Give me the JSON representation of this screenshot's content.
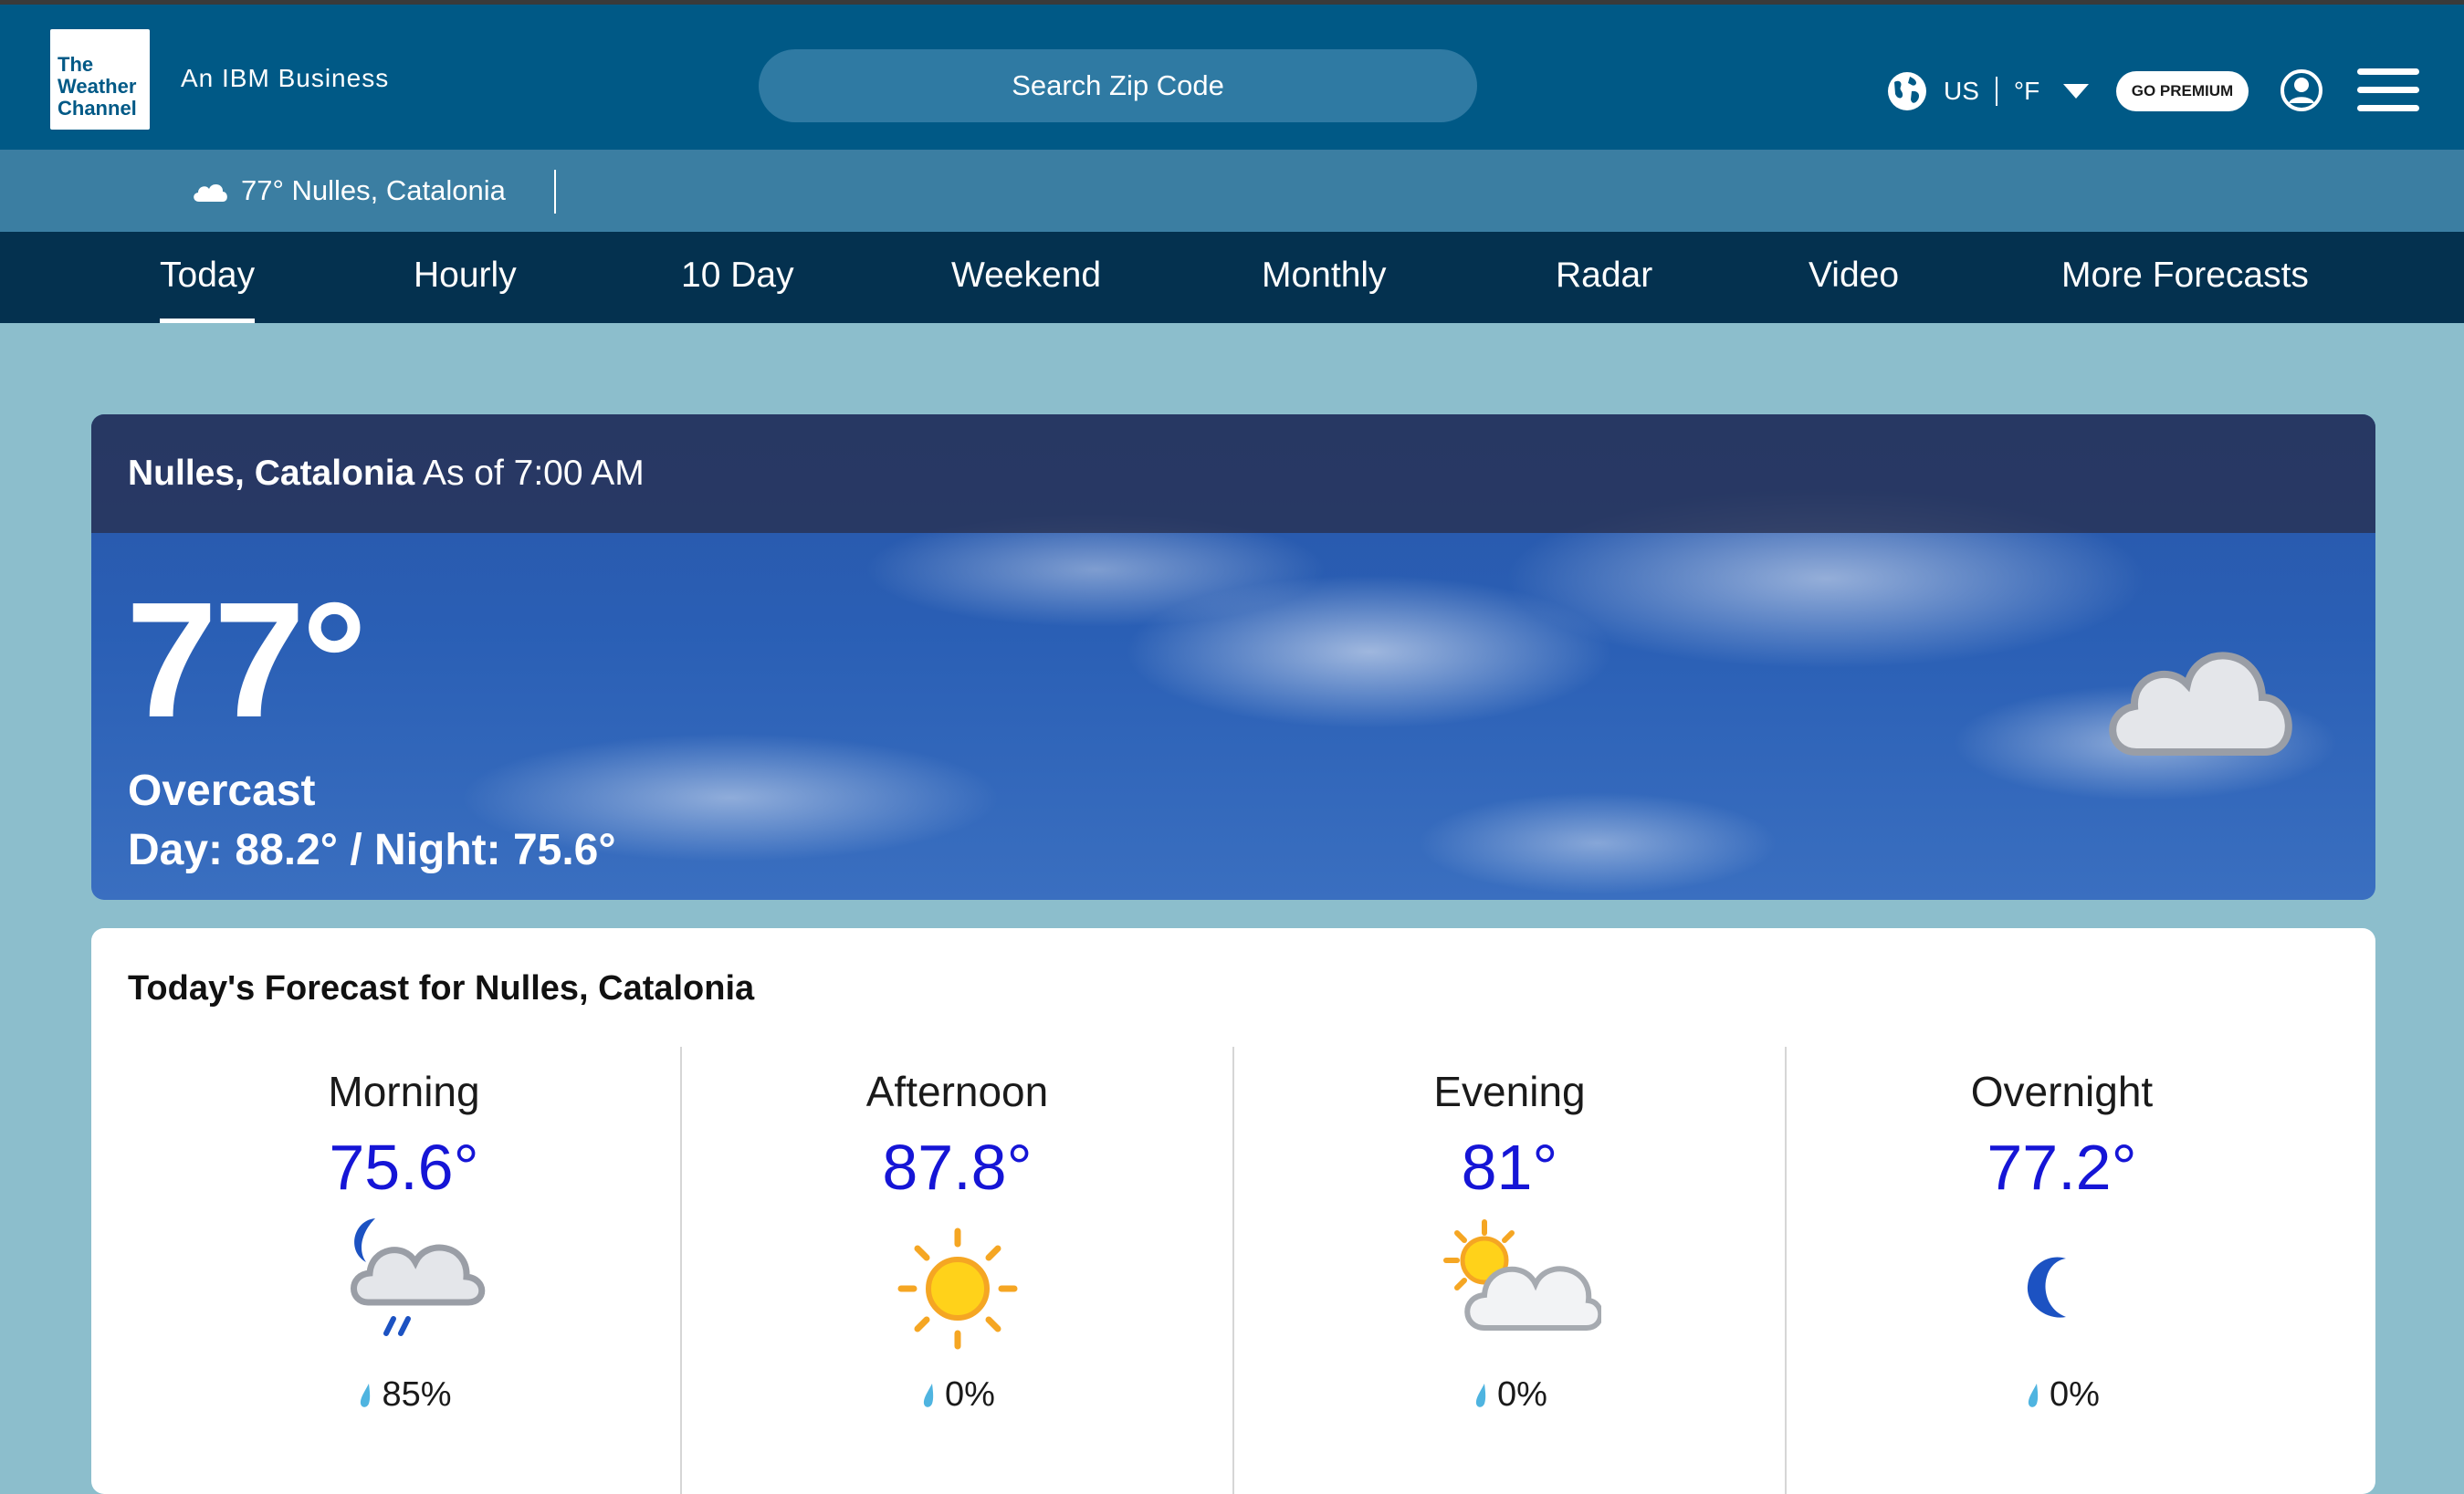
{
  "header": {
    "logo_lines": [
      "The",
      "Weather",
      "Channel"
    ],
    "tagline": "An IBM Business",
    "search_placeholder": "Search Zip Code",
    "locale_country": "US",
    "locale_unit": "°F",
    "premium_label": "GO PREMIUM",
    "icons": [
      "globe-icon",
      "chevron-down-icon",
      "account-icon",
      "menu-icon"
    ]
  },
  "location_bar": {
    "current": "77° Nulles, Catalonia",
    "icon": "cloud-icon"
  },
  "nav": {
    "tabs": [
      "Today",
      "Hourly",
      "10 Day",
      "Weekend",
      "Monthly",
      "Radar",
      "Video",
      "More Forecasts"
    ],
    "active": "Today"
  },
  "current": {
    "location": "Nulles, Catalonia",
    "as_of": "As of 7:00 AM",
    "temperature": "77°",
    "condition": "Overcast",
    "day_night": "Day: 88.2° / Night: 75.6°",
    "icon": "cloud-icon"
  },
  "forecast": {
    "title": "Today's Forecast for Nulles, Catalonia",
    "periods": [
      {
        "name": "Morning",
        "temp": "75.6°",
        "icon": "night-rain-icon",
        "precip": "85%"
      },
      {
        "name": "Afternoon",
        "temp": "87.8°",
        "icon": "sun-icon",
        "precip": "0%"
      },
      {
        "name": "Evening",
        "temp": "81°",
        "icon": "partly-cloudy-icon",
        "precip": "0%"
      },
      {
        "name": "Overnight",
        "temp": "77.2°",
        "icon": "moon-icon",
        "precip": "0%"
      }
    ]
  },
  "colors": {
    "header_bg": "#005986",
    "location_bar_bg": "#3b7ea2",
    "nav_bg": "#04314f",
    "page_bg": "#8cbecc",
    "forecast_temp": "#1515d6"
  }
}
